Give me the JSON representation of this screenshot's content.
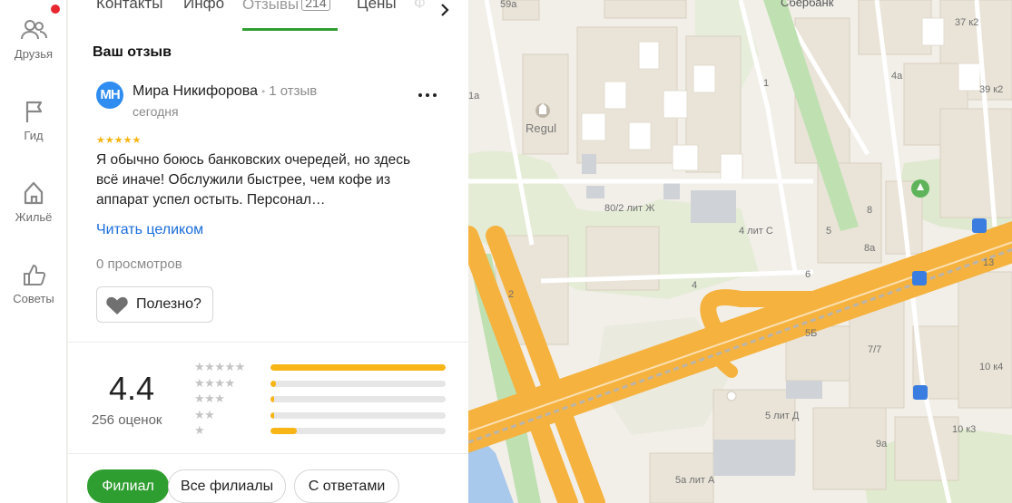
{
  "rail": {
    "items": [
      {
        "label": "Друзья",
        "icon": "friends-icon"
      },
      {
        "label": "Гид",
        "icon": "flag-icon"
      },
      {
        "label": "Жильё",
        "icon": "house-icon"
      },
      {
        "label": "Советы",
        "icon": "thumbs-up-icon"
      }
    ]
  },
  "tabs": {
    "items": [
      "Контакты",
      "Инфо",
      "Отзывы",
      "Цены",
      "Ф"
    ],
    "reviews_count": "214",
    "active": "Отзывы"
  },
  "my_review": {
    "section_title": "Ваш отзыв",
    "avatar_initials": "МН",
    "author": "Мира Никифорова",
    "author_reviews": "1 отзыв",
    "date": "сегодня",
    "stars": "★★★★★",
    "text": "Я обычно боюсь банковских очередей, но здесь всё иначе! Обслужили быстрее, чем кофе из аппарат успел остыть. Персонал…",
    "read_more": "Читать целиком",
    "views": "0 просмотров",
    "useful_label": "Полезно?"
  },
  "rating": {
    "value": "4.4",
    "count_label": "256 оценок",
    "distribution": [
      {
        "stars": "★★★★★",
        "fraction": 1.0
      },
      {
        "stars": "★★★★",
        "fraction": 0.03
      },
      {
        "stars": "★★★",
        "fraction": 0.02
      },
      {
        "stars": "★★",
        "fraction": 0.02
      },
      {
        "stars": "★",
        "fraction": 0.15
      }
    ]
  },
  "filters": [
    {
      "label": "Филиал",
      "active": true
    },
    {
      "label": "Все филиалы",
      "active": false
    },
    {
      "label": "С ответами",
      "active": false
    }
  ],
  "map": {
    "labels": [
      "59а",
      "1а",
      "Regul",
      "1",
      "Сбербанк",
      "37 к2",
      "39 к2",
      "4а",
      "80/2 лит Ж",
      "4 лит С",
      "5",
      "8",
      "8а",
      "6",
      "4",
      "2",
      "13",
      "5Б",
      "7/7",
      "10 к4",
      "5 лит Д",
      "10 к3",
      "9а",
      "5а лит А"
    ]
  },
  "colors": {
    "accent_green": "#2f9e30",
    "star_yellow": "#f7b516",
    "link_blue": "#1a6ddb",
    "road_orange": "#f5b23e",
    "avatar_blue": "#2f8cf0"
  }
}
